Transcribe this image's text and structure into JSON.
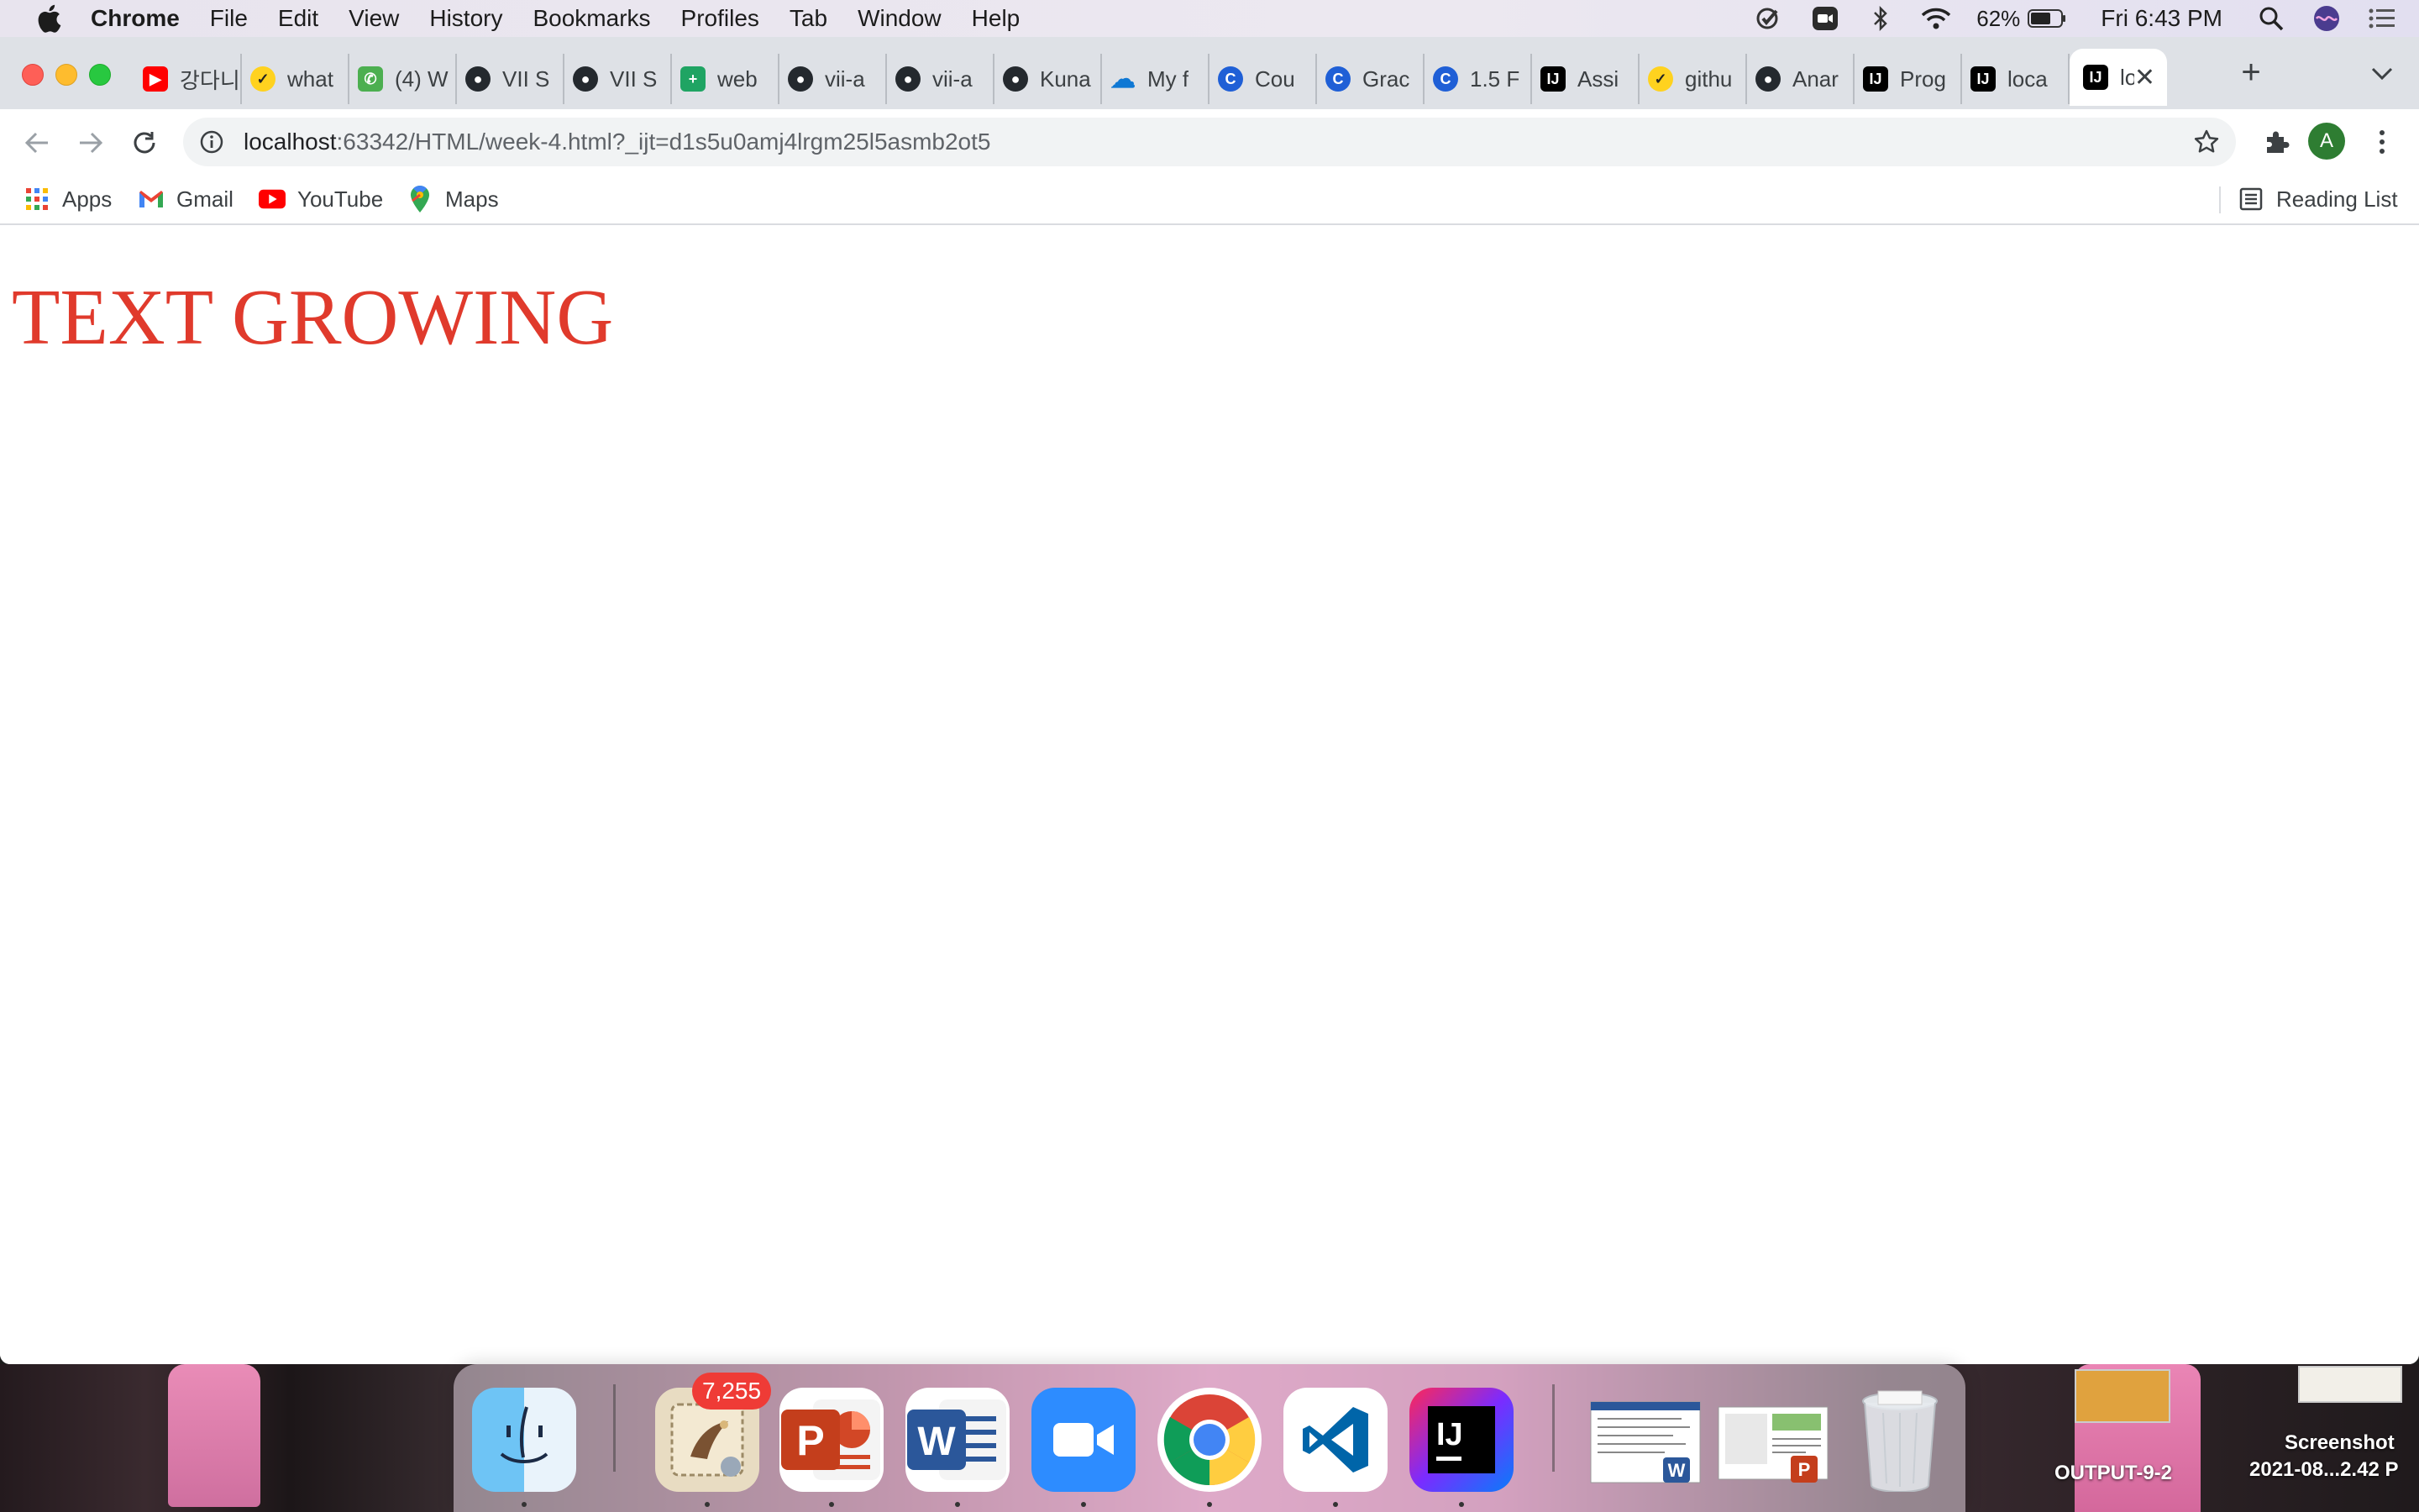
{
  "menubar": {
    "app_name": "Chrome",
    "items": [
      "File",
      "Edit",
      "View",
      "History",
      "Bookmarks",
      "Profiles",
      "Tab",
      "Window",
      "Help"
    ],
    "battery_percent": "62%",
    "clock": "Fri 6:43 PM"
  },
  "tabs": [
    {
      "title": "강다니",
      "icon": "youtube-icon",
      "color": "#ff0000"
    },
    {
      "title": "what",
      "icon": "norton-check-icon",
      "color": "#ffd21f"
    },
    {
      "title": "(4) W",
      "icon": "whatsapp-icon",
      "color": "#4caf50"
    },
    {
      "title": "VII S",
      "icon": "github-icon",
      "color": "#24292e"
    },
    {
      "title": "VII S",
      "icon": "github-icon",
      "color": "#24292e"
    },
    {
      "title": "web",
      "icon": "google-sheets-icon",
      "color": "#1fa463"
    },
    {
      "title": "vii-a",
      "icon": "github-icon",
      "color": "#24292e"
    },
    {
      "title": "vii-a",
      "icon": "github-icon",
      "color": "#24292e"
    },
    {
      "title": "Kuna",
      "icon": "github-icon",
      "color": "#24292e"
    },
    {
      "title": "My f",
      "icon": "onedrive-icon",
      "color": "#0f78d4"
    },
    {
      "title": "Cou",
      "icon": "coursera-icon",
      "color": "#1f5fd6"
    },
    {
      "title": "Grac",
      "icon": "coursera-icon",
      "color": "#1f5fd6"
    },
    {
      "title": "1.5 F",
      "icon": "coursera-icon",
      "color": "#1f5fd6"
    },
    {
      "title": "Assi",
      "icon": "intellij-icon",
      "color": "#000000"
    },
    {
      "title": "githu",
      "icon": "norton-check-icon",
      "color": "#ffd21f"
    },
    {
      "title": "Anar",
      "icon": "github-icon",
      "color": "#24292e"
    },
    {
      "title": "Prog",
      "icon": "intellij-icon",
      "color": "#000000"
    },
    {
      "title": "loca",
      "icon": "intellij-icon",
      "color": "#000000"
    }
  ],
  "active_tab": {
    "title": "lo",
    "icon": "intellij-icon",
    "close_label": "✕"
  },
  "omnibox": {
    "host": "localhost",
    "rest": ":63342/HTML/week-4.html?_ijt=d1s5u0amj4lrgm25l5asmb2ot5"
  },
  "profile_initial": "A",
  "bookmarks": {
    "items": [
      {
        "label": "Apps",
        "icon": "apps-grid-icon"
      },
      {
        "label": "Gmail",
        "icon": "gmail-icon"
      },
      {
        "label": "YouTube",
        "icon": "youtube-icon"
      },
      {
        "label": "Maps",
        "icon": "maps-pin-icon"
      }
    ],
    "reading_list": "Reading List"
  },
  "page": {
    "heading": "TEXT GROWING",
    "heading_color": "#e03a2c"
  },
  "dock": {
    "mail_badge": "7,255",
    "apps": [
      "Finder",
      "Mail",
      "PowerPoint",
      "Word",
      "Zoom",
      "Chrome",
      "Visual Studio Code",
      "IntelliJ IDEA",
      "Downloads",
      "Documents",
      "Trash"
    ]
  },
  "desktop": {
    "file_label": "OUTPUT-9-2",
    "screenshot_label_1": "Screenshot",
    "screenshot_label_2": "2021-08...2.42 P"
  }
}
